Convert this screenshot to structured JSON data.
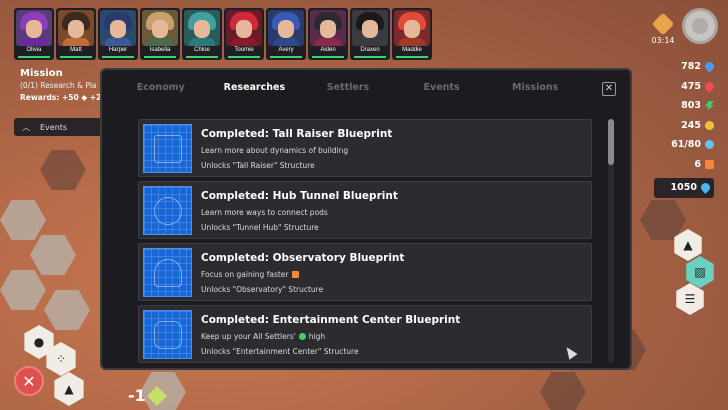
{
  "settlers": [
    {
      "name": "Olivia",
      "hair": "#8a3fb8",
      "body": "#6a2a9a"
    },
    {
      "name": "Matt",
      "hair": "#3a2a20",
      "body": "#c06a3a"
    },
    {
      "name": "Harper",
      "hair": "#2a3a6a",
      "body": "#3a5a9a"
    },
    {
      "name": "Isabella",
      "hair": "#c8a070",
      "body": "#4a6a4a"
    },
    {
      "name": "Chloe",
      "hair": "#40a0a0",
      "body": "#2a7a7a"
    },
    {
      "name": "Toomie",
      "hair": "#d02a3a",
      "body": "#8a1a2a"
    },
    {
      "name": "Avery",
      "hair": "#3a5ab8",
      "body": "#2a4a8a"
    },
    {
      "name": "Aiden",
      "hair": "#2a2a30",
      "body": "#8a2a4a"
    },
    {
      "name": "Draxen",
      "hair": "#1a1a1a",
      "body": "#3a3a40"
    },
    {
      "name": "Maddie",
      "hair": "#e04a3a",
      "body": "#a03a2a"
    }
  ],
  "mission": {
    "title": "Mission",
    "subtitle": "(0/1) Research & Pla",
    "rewards": "Rewards: +50 ◆ +2",
    "events_label": "Events"
  },
  "timer": "03:14",
  "resources": [
    {
      "value": "782",
      "icon": "water-drop-icon",
      "color": "#4a9af0",
      "shape": "drop"
    },
    {
      "value": "475",
      "icon": "food-drop-icon",
      "color": "#f04a5a",
      "shape": "drop"
    },
    {
      "value": "803",
      "icon": "energy-bolt-icon",
      "color": "#3ad08a",
      "shape": "bolt"
    },
    {
      "value": "245",
      "icon": "gold-coin-icon",
      "color": "#f0c040",
      "shape": "circle"
    },
    {
      "value": "61/80",
      "icon": "oxygen-icon",
      "color": "#6ac0f0",
      "shape": "circle"
    },
    {
      "value": "6",
      "icon": "research-icon",
      "color": "#f08a3a",
      "shape": "square"
    },
    {
      "value": "1050",
      "icon": "crystal-drop-icon",
      "color": "#4ab8f0",
      "shape": "drop"
    }
  ],
  "bottom_count": "-1",
  "modal": {
    "tabs": [
      "Economy",
      "Researches",
      "Settlers",
      "Events",
      "Missions"
    ],
    "active_tab": 1,
    "close_glyph": "✕",
    "items": [
      {
        "title": "Completed: Tall Raiser Blueprint",
        "desc": "Learn more about dynamics of building",
        "desc_icon": "",
        "desc_suffix": "",
        "unlock": "Unlocks \"Tall Raiser\" Structure"
      },
      {
        "title": "Completed: Hub Tunnel Blueprint",
        "desc": "Learn more ways to connect pods",
        "desc_icon": "",
        "desc_suffix": "",
        "unlock": "Unlocks \"Tunnel Hub\" Structure"
      },
      {
        "title": "Completed: Observatory Blueprint",
        "desc": "Focus on gaining faster",
        "desc_icon": "#f08a3a",
        "desc_suffix": "",
        "unlock": "Unlocks \"Observatory\" Structure"
      },
      {
        "title": "Completed: Entertainment Center Blueprint",
        "desc": "Keep up your All Settlers'",
        "desc_icon": "#44d06a",
        "desc_suffix": "high",
        "unlock": "Unlocks \"Entertainment Center\" Structure"
      }
    ]
  }
}
